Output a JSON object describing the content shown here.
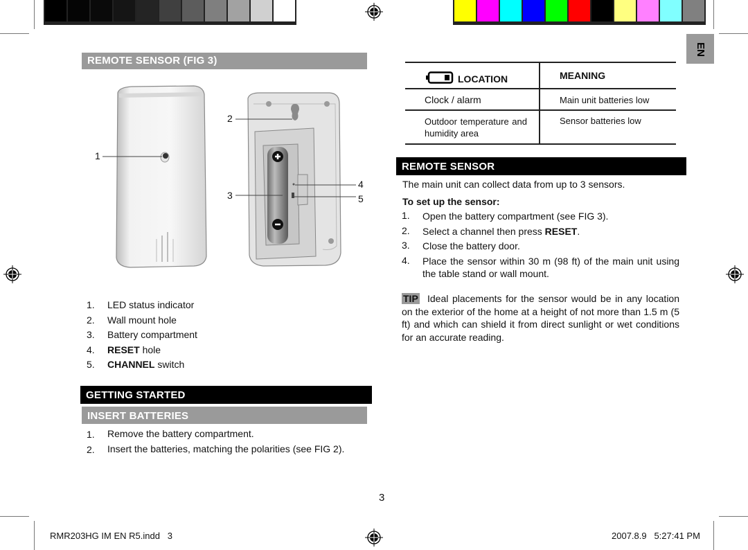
{
  "print_marks": {
    "grayscale_swatches": [
      "#000000",
      "#050505",
      "#0a0a0a",
      "#151515",
      "#242424",
      "#404040",
      "#5c5c5c",
      "#7f7f7f",
      "#a2a2a2",
      "#d0d0d0",
      "#ffffff"
    ],
    "color_swatches": [
      "#ffff00",
      "#ff00ff",
      "#00ffff",
      "#0000ff",
      "#00ff00",
      "#ff0000",
      "#000000",
      "#ffff80",
      "#ff80ff",
      "#80ffff",
      "#808080"
    ]
  },
  "language_tab": "EN",
  "left_column": {
    "fig_header": "REMOTE SENSOR (FIG 3)",
    "figure": {
      "callouts": [
        "1",
        "2",
        "3",
        "4",
        "5"
      ]
    },
    "parts_list": [
      {
        "num": "1.",
        "bold": "",
        "text": "LED status indicator"
      },
      {
        "num": "2.",
        "bold": "",
        "text": "Wall mount hole"
      },
      {
        "num": "3.",
        "bold": "",
        "text": "Battery compartment"
      },
      {
        "num": "4.",
        "bold": "RESET",
        "text": " hole"
      },
      {
        "num": "5.",
        "bold": "CHANNEL",
        "text": " switch"
      }
    ],
    "getting_started_header": "GETTING STARTED",
    "insert_batteries_header": "INSERT BATTERIES",
    "battery_steps": [
      {
        "num": "1.",
        "text": "Remove the battery compartment."
      },
      {
        "num": "2.",
        "text": "Insert the batteries, matching the polarities (see FIG 2)."
      }
    ]
  },
  "right_column": {
    "table": {
      "col1_header": "LOCATION",
      "col2_header": "MEANING",
      "rows": [
        {
          "location": "Clock / alarm",
          "meaning": "Main unit batteries low"
        },
        {
          "location": "Outdoor temperature and humidity area",
          "meaning": "Sensor batteries low"
        }
      ]
    },
    "remote_sensor_header": "REMOTE SENSOR",
    "intro": "The main unit can collect data from up to 3 sensors.",
    "setup_title": "To set up the sensor:",
    "setup_steps": [
      {
        "num": "1.",
        "pre": "Open the battery compartment (see FIG 3).",
        "bold": "",
        "post": ""
      },
      {
        "num": "2.",
        "pre": "Select a channel then press ",
        "bold": "RESET",
        "post": "."
      },
      {
        "num": "3.",
        "pre": "Close the battery door.",
        "bold": "",
        "post": ""
      },
      {
        "num": "4.",
        "pre": "Place the sensor within 30 m (98 ft) of the main unit using the table stand or wall mount.",
        "bold": "",
        "post": ""
      }
    ],
    "tip_label": "TIP",
    "tip_text": "Ideal placements for the sensor would be in any location on the exterior of the home at a height of not more than 1.5 m (5 ft) and which can shield it from direct sunlight or wet conditions for an accurate reading."
  },
  "page_number": "3",
  "footer": {
    "file": "RMR203HG IM EN R5.indd   3",
    "timestamp": "2007.8.9   5:27:41 PM"
  }
}
